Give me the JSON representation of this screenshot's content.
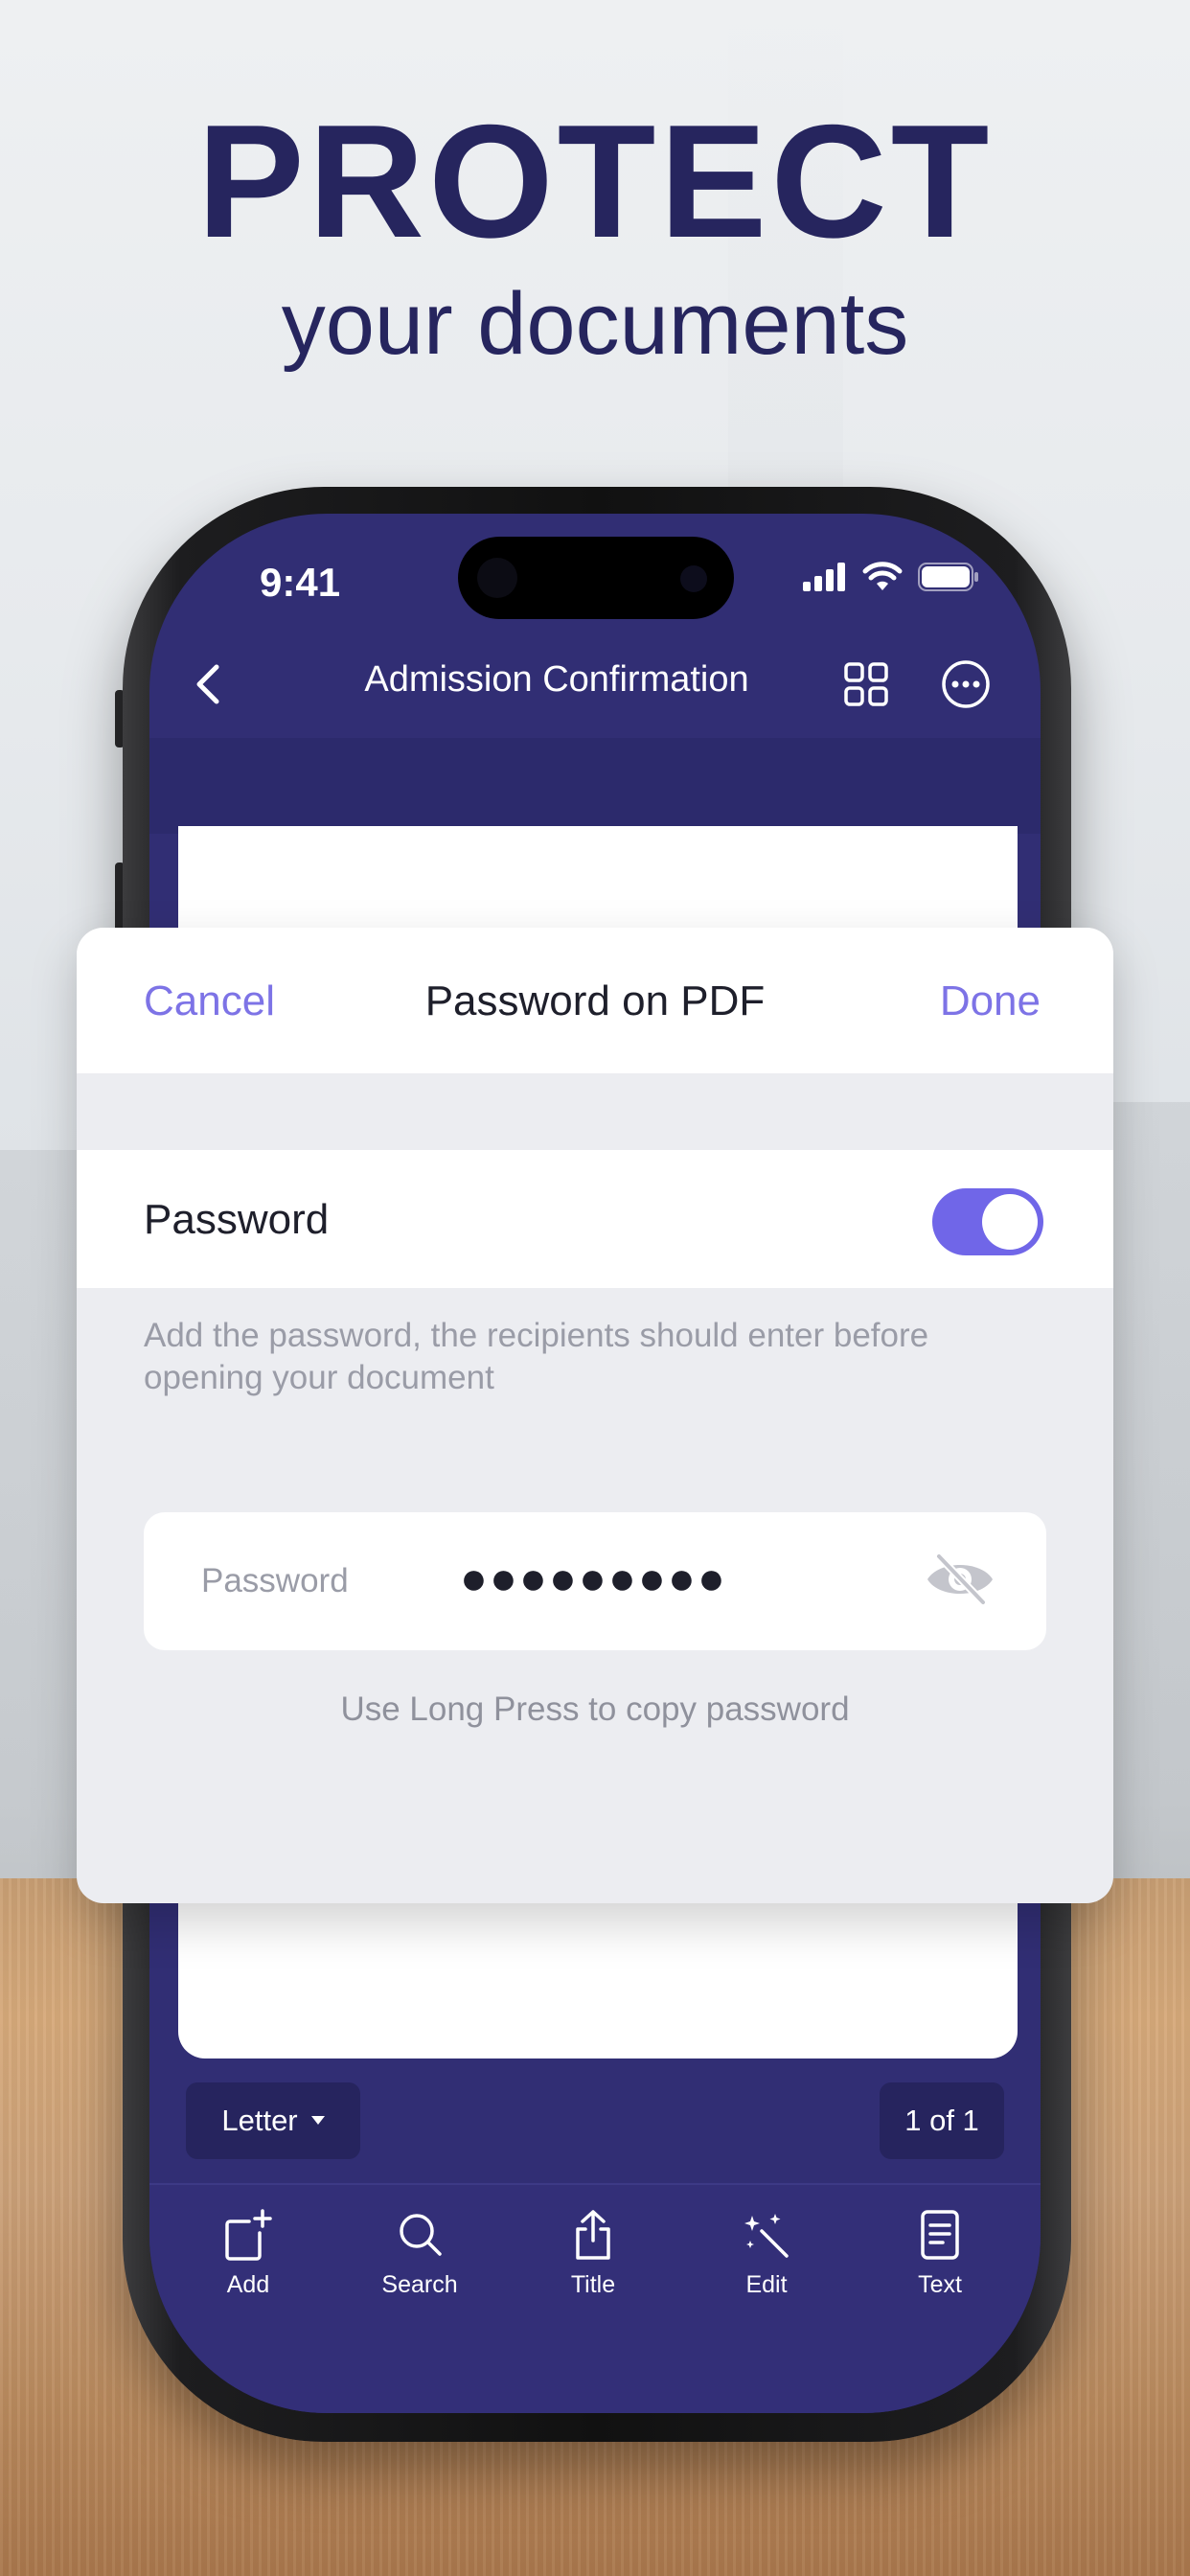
{
  "headline": "PROTECT",
  "subheadline": "your documents",
  "status_bar": {
    "time": "9:41"
  },
  "nav": {
    "title": "Admission Confirmation"
  },
  "sheet": {
    "cancel_label": "Cancel",
    "title": "Password on PDF",
    "done_label": "Done",
    "toggle_label": "Password",
    "toggle_on": true,
    "hint": "Add the password, the recipients should enter before opening your document",
    "password_field": {
      "label": "Password",
      "value": "●●●●●●●●●"
    },
    "copy_hint": "Use Long Press to copy password"
  },
  "page_size": {
    "label": "Letter"
  },
  "page_counter": "1 of 1",
  "toolbar": {
    "items": [
      {
        "label": "Add",
        "icon": "add-page-icon"
      },
      {
        "label": "Search",
        "icon": "search-icon"
      },
      {
        "label": "Title",
        "icon": "share-icon"
      },
      {
        "label": "Edit",
        "icon": "magic-wand-icon"
      },
      {
        "label": "Text",
        "icon": "document-text-icon"
      }
    ]
  },
  "colors": {
    "headline": "#26255e",
    "app_bar": "#312e74",
    "accent": "#7d73e6",
    "toggle": "#7066e8"
  }
}
